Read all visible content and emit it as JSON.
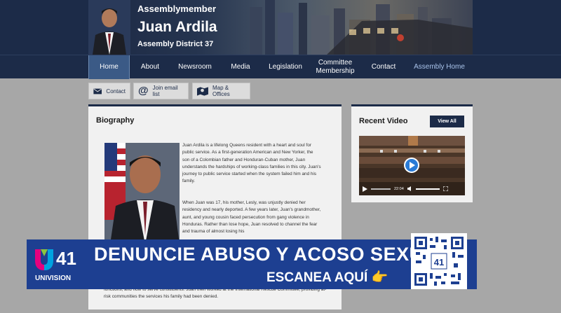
{
  "header": {
    "title": "Assemblymember",
    "name": "Juan Ardila",
    "district": "Assembly District 37"
  },
  "nav": {
    "items": [
      {
        "label": "Home"
      },
      {
        "label": "About"
      },
      {
        "label": "Newsroom"
      },
      {
        "label": "Media"
      },
      {
        "label": "Legislation"
      },
      {
        "label": "Committee Membership"
      },
      {
        "label": "Contact"
      },
      {
        "label": "Assembly Home"
      }
    ],
    "active": "Home"
  },
  "actions": {
    "contact": "Contact",
    "email": "Join email list",
    "map": "Map & Offices"
  },
  "biography": {
    "title": "Biography",
    "p1": "Juan Ardila is a lifelong Queens resident with a heart and soul for public service. As a first-generation American and New Yorker, the son of a Colombian father and Honduran-Cuban mother, Juan understands the hardships of working-class families in this city. Juan's journey to public service started when the system failed him and his family.",
    "p2": "When Juan was 17, his mother, Lesly, was unjustly denied her residency and nearly deported. A few years later, Juan's grandmother, aunt, and young cousin faced persecution from gang violence in Honduras. Rather than lose hope, Juan resolved to channel the fear and trauma of almost losing his",
    "p3": "functions, and how to serve constituents. Juan then worked at the International Rescue Committee, providing at-risk communities the services his family had been denied."
  },
  "recent_video": {
    "title": "Recent Video",
    "view_all": "View All",
    "time": "22:04"
  },
  "banner": {
    "line1": "DENUNCIE ABUSO Y ACOSO SEXUAL",
    "line2": "ESCANEA AQUÍ 👉",
    "logo_number": "41",
    "logo_name": "UNIVISION"
  },
  "colors": {
    "navy": "#1c2b48",
    "active_nav": "#3b5a86",
    "banner_blue": "#1d3f91",
    "page_bg": "#a7a7a7"
  }
}
